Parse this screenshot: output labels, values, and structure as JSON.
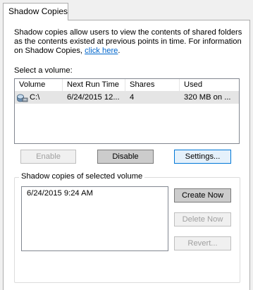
{
  "tab": {
    "label": "Shadow Copies"
  },
  "description": {
    "text": "Shadow copies allow users to view the contents of shared folders as the contents existed at previous points in time. For information on Shadow Copies, ",
    "link": "click here",
    "suffix": "."
  },
  "volume_section": {
    "label": "Select a volume:"
  },
  "volumes": {
    "columns": [
      "Volume",
      "Next Run Time",
      "Shares",
      "Used"
    ],
    "rows": [
      {
        "volume": "C:\\",
        "next_run": "6/24/2015 12...",
        "shares": "4",
        "used": "320 MB on ..."
      }
    ]
  },
  "buttons": {
    "enable": "Enable",
    "disable": "Disable",
    "settings": "Settings...",
    "create_now": "Create Now",
    "delete_now": "Delete Now",
    "revert": "Revert..."
  },
  "copies_group": {
    "title": "Shadow copies of selected volume",
    "items": [
      "6/24/2015 9:24 AM"
    ]
  }
}
